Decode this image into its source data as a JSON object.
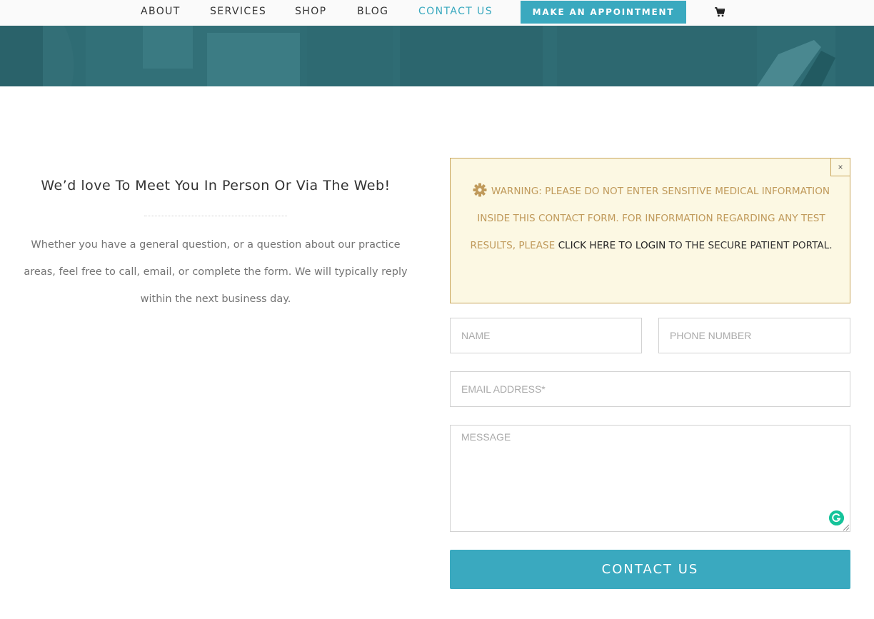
{
  "nav": {
    "items": [
      {
        "label": "ABOUT"
      },
      {
        "label": "SERVICES"
      },
      {
        "label": "SHOP"
      },
      {
        "label": "BLOG"
      },
      {
        "label": "CONTACT US",
        "active": true
      }
    ],
    "appointment_button": "MAKE AN APPOINTMENT",
    "cart_icon": "shopping-cart-icon"
  },
  "intro": {
    "title": "We’d love To Meet You In Person Or Via The Web!",
    "text": "Whether you have a general question, or a question about our practice areas, feel free to call, email, or complete the form. We will typically reply within the next business day."
  },
  "warning": {
    "icon": "gear-icon",
    "close_label": "×",
    "text_before": "WARNING: PLEASE DO NOT ENTER SENSITIVE MEDICAL INFORMATION INSIDE THIS CONTACT FORM. FOR INFORMATION REGARDING ANY TEST RESULTS, PLEASE ",
    "link_text": "CLICK HERE TO LOGIN",
    "text_after": " TO THE SECURE PATIENT PORTAL."
  },
  "form": {
    "name_placeholder": "NAME",
    "phone_placeholder": "PHONE NUMBER",
    "email_placeholder": "EMAIL ADDRESS*",
    "message_placeholder": "MESSAGE",
    "submit_label": "CONTACT US"
  },
  "colors": {
    "accent": "#3aa9bf",
    "hero": "#2e6b73",
    "warning_bg": "#fcf8e3",
    "warning_border": "#c8a55a",
    "warning_text": "#c09a5b"
  }
}
